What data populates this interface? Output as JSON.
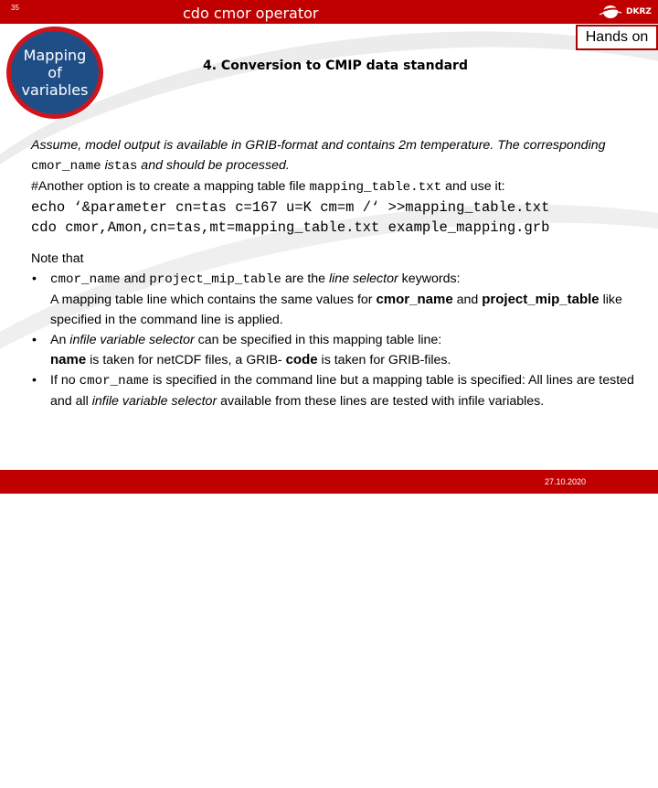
{
  "header": {
    "slide_number": "35",
    "title": "cdo cmor operator",
    "logo_text": "DKRZ"
  },
  "badge": {
    "line1": "Mapping",
    "line2": "of",
    "line3": "variables"
  },
  "hands_on_label": "Hands on",
  "section_title": "4. Conversion to CMIP data standard",
  "intro": {
    "p1_a": "Assume, model output is available in GRIB-format and contains 2m temperature. The corresponding ",
    "p1_code1": "cmor_name",
    "p1_b": " is",
    "p1_code2": "tas",
    "p1_c": " and should be processed.",
    "p2_a": "#Another option is to create a mapping table file ",
    "p2_code": "mapping_table.txt",
    "p2_b": " and use it:",
    "code1": "echo ‘&parameter cn=tas c=167 u=K cm=m /‘ >>mapping_table.txt",
    "code2": "cdo cmor,Amon,cn=tas,mt=mapping_table.txt example_mapping.grb"
  },
  "notes": {
    "heading": "Note that",
    "b1_code1": "cmor_name",
    "b1_a": " and ",
    "b1_code2": "project_mip_table",
    "b1_b": " are the ",
    "b1_it": "line selector",
    "b1_c": " keywords:",
    "b1_d": "A mapping table line which contains the same values for ",
    "b1_bold1": "cmor_name",
    "b1_e": " and ",
    "b1_bold2": "project_mip_table",
    "b1_f": " like specified in the command line is applied.",
    "b2_a": "An ",
    "b2_it": "infile variable selector",
    "b2_b": " can be specified in this mapping table line:",
    "b2_bold1": "name",
    "b2_c": " is taken for netCDF files, a GRIB- ",
    "b2_bold2": "code",
    "b2_d": " is taken for GRIB-files.",
    "b3_a": "If no ",
    "b3_code": "cmor_name",
    "b3_b": " is specified in the command line but a mapping table is specified: All lines are tested and all ",
    "b3_it": "infile variable selector",
    "b3_c": " available from these lines are tested with infile variables."
  },
  "footer": {
    "date": "27.10.2020"
  },
  "colors": {
    "brand_red": "#c00000",
    "badge_blue": "#1f4e87",
    "badge_ring": "#d0141c"
  }
}
